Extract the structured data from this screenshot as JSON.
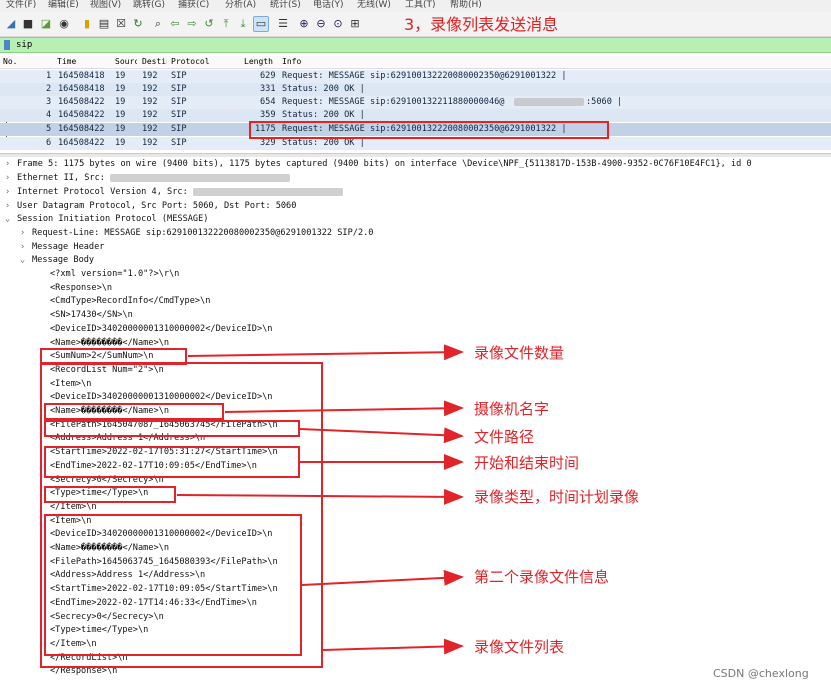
{
  "menu": [
    "文件(F)",
    "编辑(E)",
    "视图(V)",
    "跳转(G)",
    "捕获(C)",
    "分析(A)",
    "统计(S)",
    "电话(Y)",
    "无线(W)",
    "工具(T)",
    "帮助(H)"
  ],
  "toolbar_annotation": "3，录像列表发送消息",
  "toolbar_icons": [
    "shark-fin-icon",
    "stop-icon",
    "restart-icon",
    "options-icon",
    "open-icon",
    "file-icon",
    "close-file-icon",
    "reload-icon",
    "find-icon",
    "back-icon",
    "forward-icon",
    "go-to-icon",
    "first-icon",
    "last-icon",
    "autoscroll-icon",
    "colorize-icon",
    "zoom-in-icon",
    "zoom-out-icon",
    "zoom-normal-icon",
    "resize-columns-icon"
  ],
  "filter": {
    "value": "sip"
  },
  "columns": [
    "No.",
    "Time",
    "Source",
    "Destination",
    "Protocol",
    "Length",
    "Info"
  ],
  "packets": [
    {
      "no": "1",
      "time": "164508418",
      "src": "19",
      "dst": "192",
      "proto": "SIP",
      "len": "629",
      "info": "Request: MESSAGE sip:629100132220080002350@6291001322 |"
    },
    {
      "no": "2",
      "time": "164508418",
      "src": "19",
      "dst": "192",
      "proto": "SIP",
      "len": "331",
      "info": "Status: 200 OK |"
    },
    {
      "no": "3",
      "time": "164508422",
      "src": "19",
      "dst": "192",
      "proto": "SIP",
      "len": "654",
      "info": "Request: MESSAGE sip:629100132211880000046@"
    },
    {
      "no": "4",
      "time": "164508422",
      "src": "19",
      "dst": "192",
      "proto": "SIP",
      "len": "359",
      "info": "Status: 200 OK |"
    },
    {
      "no": "5",
      "time": "164508422",
      "src": "19",
      "dst": "192",
      "proto": "SIP",
      "len": "1175",
      "info": "Request: MESSAGE sip:629100132220080002350@6291001322 |"
    },
    {
      "no": "6",
      "time": "164508422",
      "src": "19",
      "dst": "192",
      "proto": "SIP",
      "len": "329",
      "info": "Status: 200 OK |"
    }
  ],
  "packet3_tail": ":5060 |",
  "details": {
    "frame": "Frame 5: 1175 bytes on wire (9400 bits), 1175 bytes captured (9400 bits) on interface \\Device\\NPF_{5113817D-153B-4900-9352-0C76F10E4FC1}, id 0",
    "ethernet": "Ethernet II, Src:",
    "ip": "Internet Protocol Version 4, Src:",
    "udp": "User Datagram Protocol, Src Port: 5060, Dst Port: 5060",
    "sip": "Session Initiation Protocol (MESSAGE)",
    "request_line": "Request-Line: MESSAGE sip:629100132220080002350@6291001322 SIP/2.0",
    "message_header": "Message Header",
    "message_body": "Message Body"
  },
  "body_lines": [
    "<?xml version=\"1.0\"?>\\r\\n",
    "<Response>\\n",
    "<CmdType>RecordInfo</CmdType>\\n",
    "<SN>17430</SN>\\n",
    "<DeviceID>34020000001310000002</DeviceID>\\n",
    "<Name>��������</Name>\\n",
    "<SumNum>2</SumNum>\\n",
    "<RecordList Num=\"2\">\\n",
    "<Item>\\n",
    "<DeviceID>34020000001310000002</DeviceID>\\n",
    "<Name>��������</Name>\\n",
    "<FilePath>1645047087_1645063745</FilePath>\\n",
    "<Address>Address 1</Address>\\n",
    "<StartTime>2022-02-17T05:31:27</StartTime>\\n",
    "<EndTime>2022-02-17T10:09:05</EndTime>\\n",
    "<Secrecy>0</Secrecy>\\n",
    "<Type>time</Type>\\n",
    "</Item>\\n",
    "<Item>\\n",
    "<DeviceID>34020000001310000002</DeviceID>\\n",
    "<Name>��������</Name>\\n",
    "<FilePath>1645063745_1645080393</FilePath>\\n",
    "<Address>Address 1</Address>\\n",
    "<StartTime>2022-02-17T10:09:05</StartTime>\\n",
    "<EndTime>2022-02-17T14:46:33</EndTime>\\n",
    "<Secrecy>0</Secrecy>\\n",
    "<Type>time</Type>\\n",
    "</Item>\\n",
    "</RecordList>\\n",
    "</Response>\\n"
  ],
  "annotations": {
    "sumnum": "录像文件数量",
    "name": "摄像机名字",
    "filepath": "文件路径",
    "time": "开始和结束时间",
    "type": "录像类型，时间计划录像",
    "second_item": "第二个录像文件信息",
    "record_list": "录像文件列表"
  },
  "watermark": "CSDN @chexlong",
  "colors": {
    "annotation_red": "#e0242a",
    "filter_green": "#b8f0b3",
    "selected_row": "#c2d2e6",
    "packet_row": "#e4ecf8"
  }
}
